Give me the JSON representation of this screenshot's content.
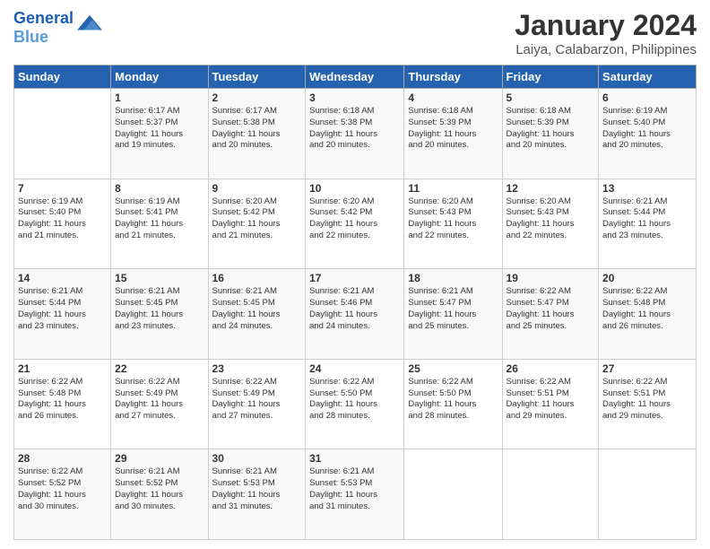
{
  "logo": {
    "line1": "General",
    "line2": "Blue"
  },
  "title": "January 2024",
  "subtitle": "Laiya, Calabarzon, Philippines",
  "weekdays": [
    "Sunday",
    "Monday",
    "Tuesday",
    "Wednesday",
    "Thursday",
    "Friday",
    "Saturday"
  ],
  "weeks": [
    [
      {
        "day": "",
        "info": ""
      },
      {
        "day": "1",
        "info": "Sunrise: 6:17 AM\nSunset: 5:37 PM\nDaylight: 11 hours\nand 19 minutes."
      },
      {
        "day": "2",
        "info": "Sunrise: 6:17 AM\nSunset: 5:38 PM\nDaylight: 11 hours\nand 20 minutes."
      },
      {
        "day": "3",
        "info": "Sunrise: 6:18 AM\nSunset: 5:38 PM\nDaylight: 11 hours\nand 20 minutes."
      },
      {
        "day": "4",
        "info": "Sunrise: 6:18 AM\nSunset: 5:39 PM\nDaylight: 11 hours\nand 20 minutes."
      },
      {
        "day": "5",
        "info": "Sunrise: 6:18 AM\nSunset: 5:39 PM\nDaylight: 11 hours\nand 20 minutes."
      },
      {
        "day": "6",
        "info": "Sunrise: 6:19 AM\nSunset: 5:40 PM\nDaylight: 11 hours\nand 20 minutes."
      }
    ],
    [
      {
        "day": "7",
        "info": "Sunrise: 6:19 AM\nSunset: 5:40 PM\nDaylight: 11 hours\nand 21 minutes."
      },
      {
        "day": "8",
        "info": "Sunrise: 6:19 AM\nSunset: 5:41 PM\nDaylight: 11 hours\nand 21 minutes."
      },
      {
        "day": "9",
        "info": "Sunrise: 6:20 AM\nSunset: 5:42 PM\nDaylight: 11 hours\nand 21 minutes."
      },
      {
        "day": "10",
        "info": "Sunrise: 6:20 AM\nSunset: 5:42 PM\nDaylight: 11 hours\nand 22 minutes."
      },
      {
        "day": "11",
        "info": "Sunrise: 6:20 AM\nSunset: 5:43 PM\nDaylight: 11 hours\nand 22 minutes."
      },
      {
        "day": "12",
        "info": "Sunrise: 6:20 AM\nSunset: 5:43 PM\nDaylight: 11 hours\nand 22 minutes."
      },
      {
        "day": "13",
        "info": "Sunrise: 6:21 AM\nSunset: 5:44 PM\nDaylight: 11 hours\nand 23 minutes."
      }
    ],
    [
      {
        "day": "14",
        "info": "Sunrise: 6:21 AM\nSunset: 5:44 PM\nDaylight: 11 hours\nand 23 minutes."
      },
      {
        "day": "15",
        "info": "Sunrise: 6:21 AM\nSunset: 5:45 PM\nDaylight: 11 hours\nand 23 minutes."
      },
      {
        "day": "16",
        "info": "Sunrise: 6:21 AM\nSunset: 5:45 PM\nDaylight: 11 hours\nand 24 minutes."
      },
      {
        "day": "17",
        "info": "Sunrise: 6:21 AM\nSunset: 5:46 PM\nDaylight: 11 hours\nand 24 minutes."
      },
      {
        "day": "18",
        "info": "Sunrise: 6:21 AM\nSunset: 5:47 PM\nDaylight: 11 hours\nand 25 minutes."
      },
      {
        "day": "19",
        "info": "Sunrise: 6:22 AM\nSunset: 5:47 PM\nDaylight: 11 hours\nand 25 minutes."
      },
      {
        "day": "20",
        "info": "Sunrise: 6:22 AM\nSunset: 5:48 PM\nDaylight: 11 hours\nand 26 minutes."
      }
    ],
    [
      {
        "day": "21",
        "info": "Sunrise: 6:22 AM\nSunset: 5:48 PM\nDaylight: 11 hours\nand 26 minutes."
      },
      {
        "day": "22",
        "info": "Sunrise: 6:22 AM\nSunset: 5:49 PM\nDaylight: 11 hours\nand 27 minutes."
      },
      {
        "day": "23",
        "info": "Sunrise: 6:22 AM\nSunset: 5:49 PM\nDaylight: 11 hours\nand 27 minutes."
      },
      {
        "day": "24",
        "info": "Sunrise: 6:22 AM\nSunset: 5:50 PM\nDaylight: 11 hours\nand 28 minutes."
      },
      {
        "day": "25",
        "info": "Sunrise: 6:22 AM\nSunset: 5:50 PM\nDaylight: 11 hours\nand 28 minutes."
      },
      {
        "day": "26",
        "info": "Sunrise: 6:22 AM\nSunset: 5:51 PM\nDaylight: 11 hours\nand 29 minutes."
      },
      {
        "day": "27",
        "info": "Sunrise: 6:22 AM\nSunset: 5:51 PM\nDaylight: 11 hours\nand 29 minutes."
      }
    ],
    [
      {
        "day": "28",
        "info": "Sunrise: 6:22 AM\nSunset: 5:52 PM\nDaylight: 11 hours\nand 30 minutes."
      },
      {
        "day": "29",
        "info": "Sunrise: 6:21 AM\nSunset: 5:52 PM\nDaylight: 11 hours\nand 30 minutes."
      },
      {
        "day": "30",
        "info": "Sunrise: 6:21 AM\nSunset: 5:53 PM\nDaylight: 11 hours\nand 31 minutes."
      },
      {
        "day": "31",
        "info": "Sunrise: 6:21 AM\nSunset: 5:53 PM\nDaylight: 11 hours\nand 31 minutes."
      },
      {
        "day": "",
        "info": ""
      },
      {
        "day": "",
        "info": ""
      },
      {
        "day": "",
        "info": ""
      }
    ]
  ]
}
